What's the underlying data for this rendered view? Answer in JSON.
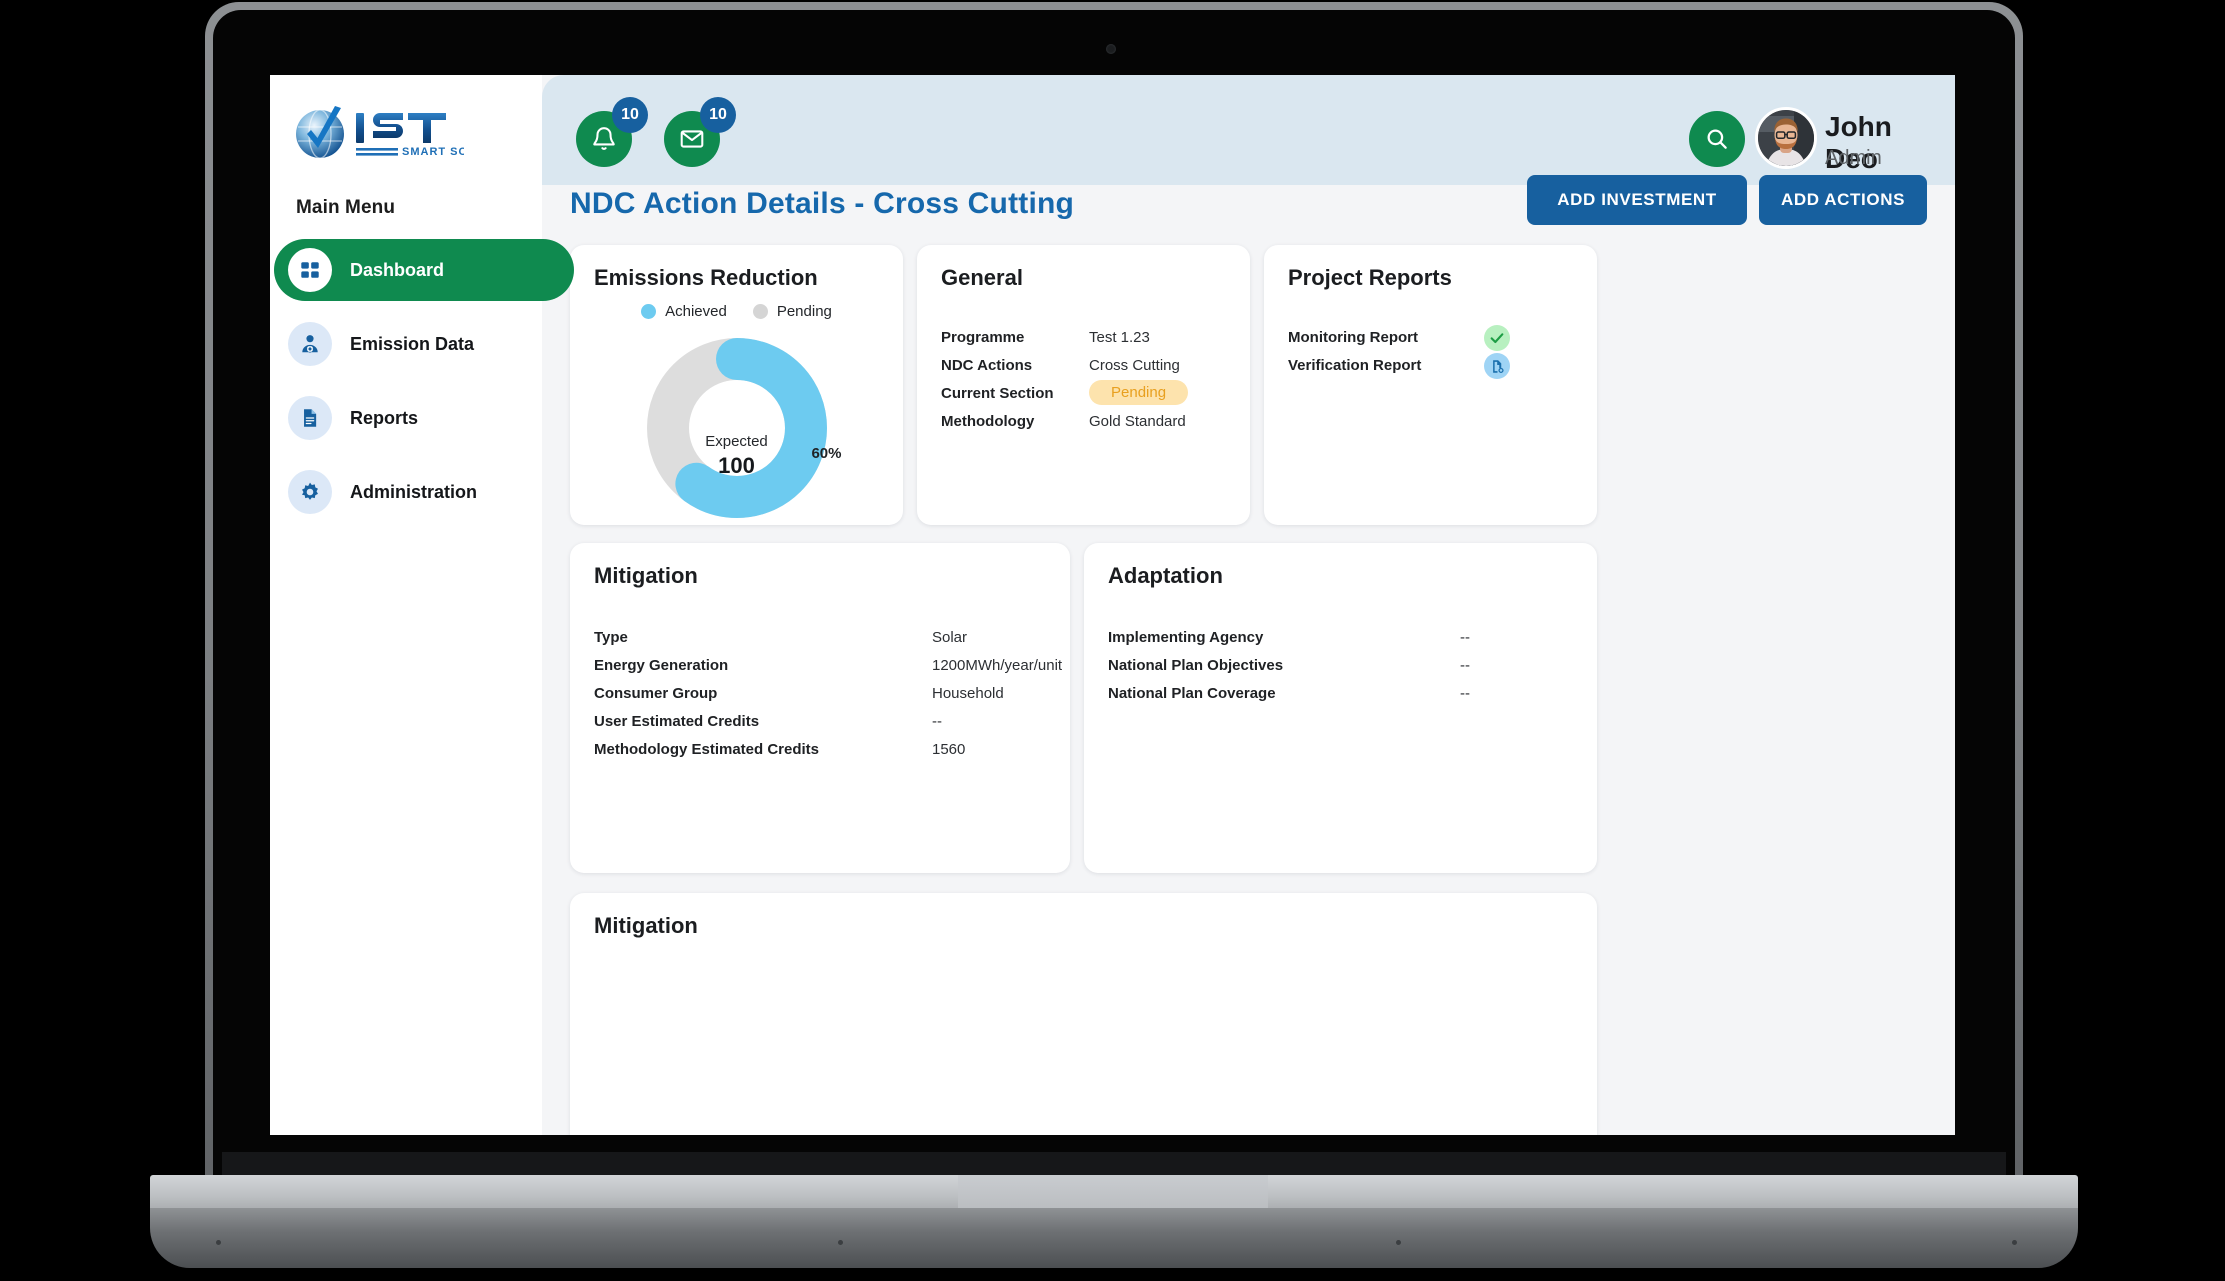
{
  "brand": {
    "name": "IST",
    "tagline": "SMART SOLUTIONS"
  },
  "sidebar": {
    "heading": "Main Menu",
    "items": [
      {
        "label": "Dashboard",
        "icon": "grid-icon",
        "active": true
      },
      {
        "label": "Emission Data",
        "icon": "user-gear-icon",
        "active": false
      },
      {
        "label": "Reports",
        "icon": "document-icon",
        "active": false
      },
      {
        "label": "Administration",
        "icon": "gear-icon",
        "active": false
      }
    ]
  },
  "topbar": {
    "notifications_count": "10",
    "messages_count": "10",
    "search_icon": "search-icon",
    "user": {
      "name": "John Deo",
      "role": "Admin"
    }
  },
  "header": {
    "title": "NDC Action Details - Cross Cutting",
    "add_investment_label": "ADD INVESTMENT",
    "add_actions_label": "ADD ACTIONS"
  },
  "chart_data": {
    "type": "pie",
    "title": "Emissions Reduction",
    "legend": [
      "Achieved",
      "Pending"
    ],
    "legend_position": "top",
    "categories": [
      "Achieved",
      "Pending"
    ],
    "values": [
      60,
      40
    ],
    "colors": [
      "#6dcbf0",
      "#dddddd"
    ],
    "center_label": "Expected",
    "center_value": "100",
    "data_label": "60%",
    "unit": "%"
  },
  "cards": {
    "emissions": {
      "title": "Emissions Reduction"
    },
    "general": {
      "title": "General",
      "rows": [
        {
          "key": "Programme",
          "value": "Test 1.23",
          "type": "text"
        },
        {
          "key": "NDC Actions",
          "value": "Cross Cutting",
          "type": "text"
        },
        {
          "key": "Current Section",
          "value": "Pending",
          "type": "pill"
        },
        {
          "key": "Methodology",
          "value": "Gold Standard",
          "type": "text"
        }
      ]
    },
    "project_reports": {
      "title": "Project Reports",
      "rows": [
        {
          "key": "Monitoring Report",
          "value": "",
          "type": "check",
          "icon": "check-circle-icon"
        },
        {
          "key": "Verification Report",
          "value": "",
          "type": "doc",
          "icon": "document-search-icon"
        }
      ]
    },
    "mitigation": {
      "title": "Mitigation",
      "rows": [
        {
          "key": "Type",
          "value": "Solar"
        },
        {
          "key": "Energy Generation",
          "value": "1200MWh/year/unit"
        },
        {
          "key": "Consumer Group",
          "value": "Household"
        },
        {
          "key": "User Estimated Credits",
          "value": "--"
        },
        {
          "key": "Methodology Estimated Credits",
          "value": "1560"
        }
      ]
    },
    "adaptation": {
      "title": "Adaptation",
      "rows": [
        {
          "key": "Implementing Agency",
          "value": "--"
        },
        {
          "key": "National Plan Objectives",
          "value": "--"
        },
        {
          "key": "National Plan Coverage",
          "value": "--"
        }
      ]
    },
    "mitigation_bottom": {
      "title": "Mitigation"
    }
  },
  "colors": {
    "brand_green": "#0f8a4f",
    "brand_blue": "#17609f",
    "title_blue": "#1668ac",
    "topbar_bg": "#dae7f0",
    "achieved": "#6dcbf0",
    "pending": "#dddddd",
    "pill_bg": "#fde3ad",
    "pill_text": "#e8a020"
  }
}
